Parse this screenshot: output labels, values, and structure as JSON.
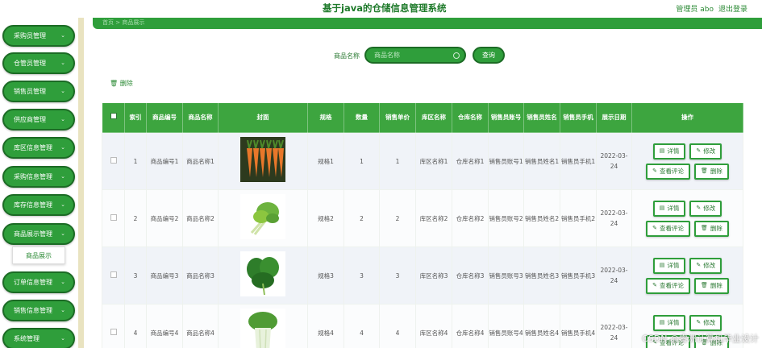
{
  "header": {
    "title": "基于java的仓储信息管理系统",
    "user": "管理员 abo",
    "logout": "退出登录"
  },
  "breadcrumb": "首页 > 商品展示",
  "sidebar": {
    "items": [
      {
        "label": "采购员管理"
      },
      {
        "label": "仓管员管理"
      },
      {
        "label": "销售员管理"
      },
      {
        "label": "供应商管理"
      },
      {
        "label": "库区信息管理"
      },
      {
        "label": "采购信息管理"
      },
      {
        "label": "库存信息管理"
      },
      {
        "label": "商品展示管理"
      },
      {
        "label": "订单信息管理"
      },
      {
        "label": "销售信息管理"
      },
      {
        "label": "系统管理"
      }
    ],
    "submenu": "商品展示"
  },
  "search": {
    "label": "商品名称",
    "placeholder": "商品名称",
    "button": "查询"
  },
  "toolbar": {
    "delete": "删除"
  },
  "table": {
    "columns": [
      "索引",
      "商品编号",
      "商品名称",
      "封面",
      "规格",
      "数量",
      "销售单价",
      "库区名称",
      "仓库名称",
      "销售员账号",
      "销售员姓名",
      "销售员手机",
      "展示日期",
      "操作"
    ],
    "rows": [
      {
        "index": "1",
        "code": "商品编号1",
        "name": "商品名称1",
        "cover": "carrot",
        "spec": "规格1",
        "qty": "1",
        "price": "1",
        "area": "库区名称1",
        "store": "仓库名称1",
        "acct": "销售员账号1",
        "seller": "销售员姓名1",
        "phone": "销售员手机1",
        "date": "2022-03-24"
      },
      {
        "index": "2",
        "code": "商品编号2",
        "name": "商品名称2",
        "cover": "celery",
        "spec": "规格2",
        "qty": "2",
        "price": "2",
        "area": "库区名称2",
        "store": "仓库名称2",
        "acct": "销售员账号2",
        "seller": "销售员姓名2",
        "phone": "销售员手机2",
        "date": "2022-03-24"
      },
      {
        "index": "3",
        "code": "商品编号3",
        "name": "商品名称3",
        "cover": "spinach",
        "spec": "规格3",
        "qty": "3",
        "price": "3",
        "area": "库区名称3",
        "store": "仓库名称3",
        "acct": "销售员账号3",
        "seller": "销售员姓名3",
        "phone": "销售员手机3",
        "date": "2022-03-24"
      },
      {
        "index": "4",
        "code": "商品编号4",
        "name": "商品名称4",
        "cover": "bokchoy",
        "spec": "规格4",
        "qty": "4",
        "price": "4",
        "area": "库区名称4",
        "store": "仓库名称4",
        "acct": "销售员账号4",
        "seller": "销售员姓名4",
        "phone": "销售员手机4",
        "date": "2022-03-24"
      }
    ],
    "ops": {
      "detail": "详情",
      "edit": "修改",
      "reviews": "查看评论",
      "delete": "删除"
    }
  },
  "watermark": "CSDN @睿洲计算机毕业设计",
  "colors": {
    "primary": "#2f9e3b",
    "header": "#3da53f",
    "sidebarStrip": "#e9e3c0"
  }
}
